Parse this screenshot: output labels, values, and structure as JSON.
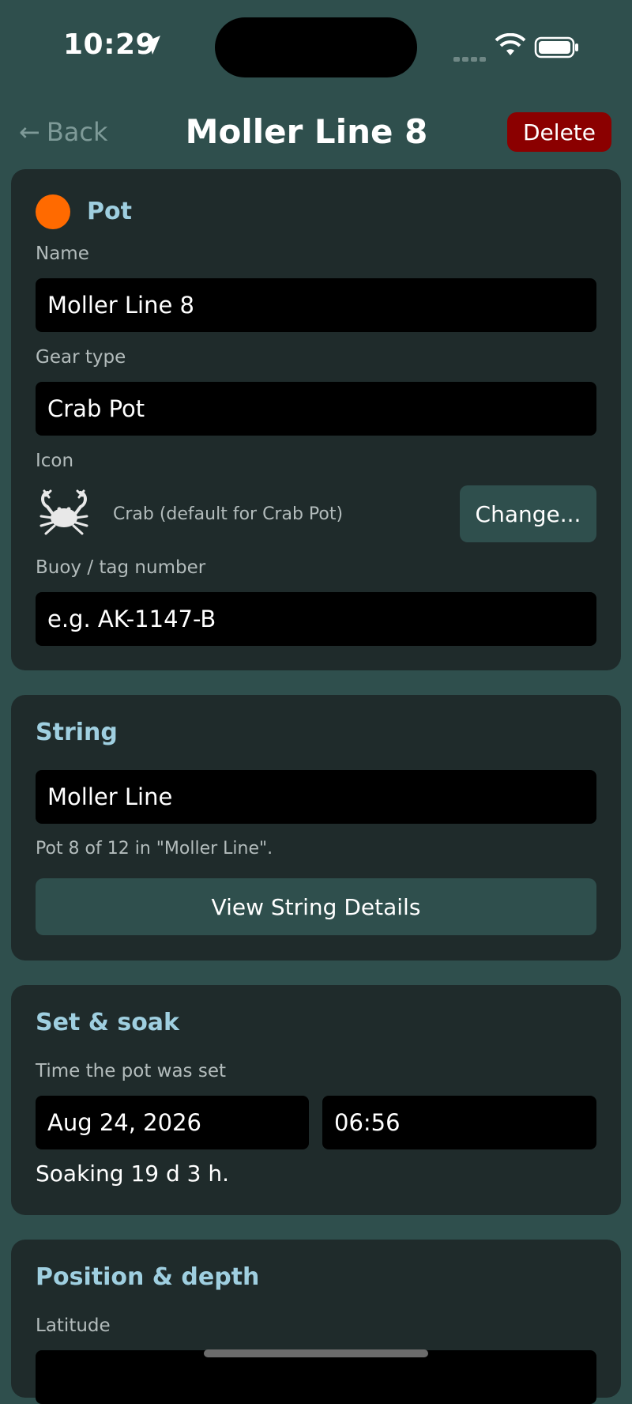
{
  "status": {
    "time": "10:29"
  },
  "nav": {
    "back_label": "Back",
    "title": "Moller Line 8",
    "delete_label": "Delete"
  },
  "pot_card": {
    "title": "Pot",
    "dot_color": "#ff6a00",
    "name_label": "Name",
    "name_value": "Moller Line 8",
    "gear_label": "Gear type",
    "gear_value": "Crab Pot",
    "icon_label": "Icon",
    "icon_name": "crab-icon",
    "icon_description": "Crab (default for Crab Pot)",
    "change_label": "Change...",
    "buoy_label": "Buoy / tag number",
    "buoy_placeholder": "e.g. AK-1147-B"
  },
  "string_card": {
    "title": "String",
    "string_value": "Moller Line",
    "position_text": "Pot 8 of 12 in \"Moller Line\".",
    "view_button": "View String Details"
  },
  "set_card": {
    "title": "Set & soak",
    "time_label": "Time the pot was set",
    "date_value": "Aug 24, 2026",
    "time_value": "06:56",
    "soak_text": "Soaking 19 d 3 h."
  },
  "position_card": {
    "title": "Position & depth",
    "latitude_label": "Latitude"
  },
  "colors": {
    "background": "#2f4f4d",
    "card": "#1f2b2b",
    "accent_title": "#9fcfe0",
    "delete": "#8b0000"
  }
}
